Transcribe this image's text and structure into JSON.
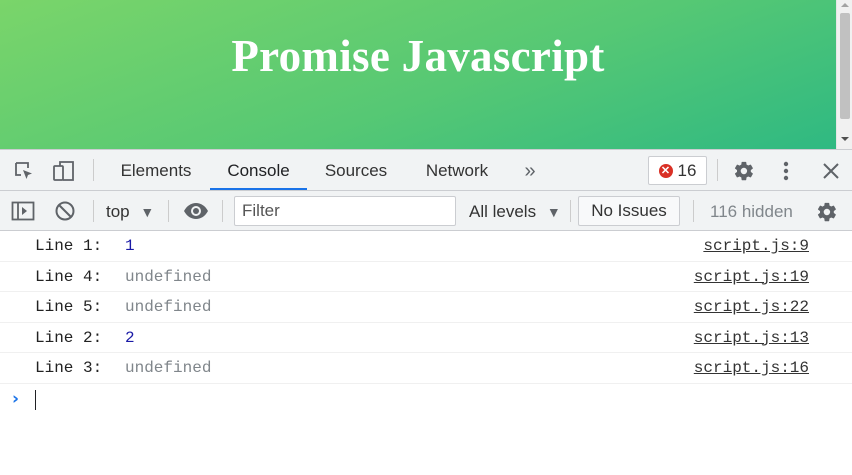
{
  "page": {
    "title": "Promise Javascript"
  },
  "devtools": {
    "tabs": [
      {
        "label": "Elements"
      },
      {
        "label": "Console"
      },
      {
        "label": "Sources"
      },
      {
        "label": "Network"
      }
    ],
    "active_tab": "Console",
    "more_tabs_glyph": "»",
    "error_count": "16",
    "icons": [
      "inspect-icon",
      "device-toolbar-icon",
      "settings-icon",
      "kebab-menu-icon",
      "close-icon"
    ]
  },
  "console_toolbar": {
    "context": "top",
    "filter_placeholder": "Filter",
    "levels": "All levels",
    "issues_button": "No Issues",
    "hidden": "116 hidden"
  },
  "console": {
    "entries": [
      {
        "label": "Line 1:",
        "value": "1",
        "source": "script.js:9"
      },
      {
        "label": "Line 4:",
        "value": "undefined",
        "source": "script.js:19"
      },
      {
        "label": "Line 5:",
        "value": "undefined",
        "source": "script.js:22"
      },
      {
        "label": "Line 2:",
        "value": "2",
        "source": "script.js:13"
      },
      {
        "label": "Line 3:",
        "value": "undefined",
        "source": "script.js:16"
      }
    ],
    "prompt_glyph": "›"
  }
}
